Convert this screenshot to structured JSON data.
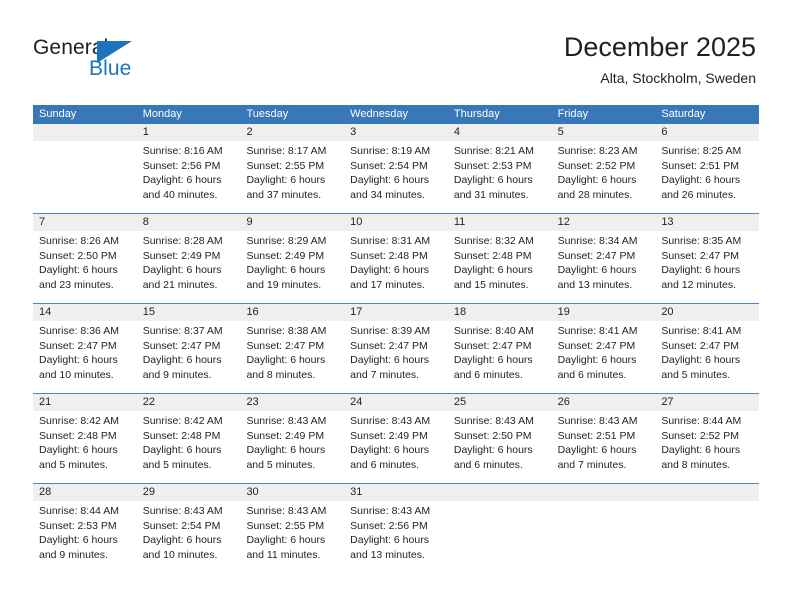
{
  "brand": {
    "name_part1": "General",
    "name_part2": "Blue",
    "accent_color": "#1c75bc"
  },
  "header": {
    "title": "December 2025",
    "subtitle": "Alta, Stockholm, Sweden"
  },
  "calendar": {
    "header_color": "#3878b9",
    "weekdays": [
      "Sunday",
      "Monday",
      "Tuesday",
      "Wednesday",
      "Thursday",
      "Friday",
      "Saturday"
    ],
    "weeks": [
      [
        {
          "day": "",
          "lines": []
        },
        {
          "day": "1",
          "lines": [
            "Sunrise: 8:16 AM",
            "Sunset: 2:56 PM",
            "Daylight: 6 hours",
            "and 40 minutes."
          ]
        },
        {
          "day": "2",
          "lines": [
            "Sunrise: 8:17 AM",
            "Sunset: 2:55 PM",
            "Daylight: 6 hours",
            "and 37 minutes."
          ]
        },
        {
          "day": "3",
          "lines": [
            "Sunrise: 8:19 AM",
            "Sunset: 2:54 PM",
            "Daylight: 6 hours",
            "and 34 minutes."
          ]
        },
        {
          "day": "4",
          "lines": [
            "Sunrise: 8:21 AM",
            "Sunset: 2:53 PM",
            "Daylight: 6 hours",
            "and 31 minutes."
          ]
        },
        {
          "day": "5",
          "lines": [
            "Sunrise: 8:23 AM",
            "Sunset: 2:52 PM",
            "Daylight: 6 hours",
            "and 28 minutes."
          ]
        },
        {
          "day": "6",
          "lines": [
            "Sunrise: 8:25 AM",
            "Sunset: 2:51 PM",
            "Daylight: 6 hours",
            "and 26 minutes."
          ]
        }
      ],
      [
        {
          "day": "7",
          "lines": [
            "Sunrise: 8:26 AM",
            "Sunset: 2:50 PM",
            "Daylight: 6 hours",
            "and 23 minutes."
          ]
        },
        {
          "day": "8",
          "lines": [
            "Sunrise: 8:28 AM",
            "Sunset: 2:49 PM",
            "Daylight: 6 hours",
            "and 21 minutes."
          ]
        },
        {
          "day": "9",
          "lines": [
            "Sunrise: 8:29 AM",
            "Sunset: 2:49 PM",
            "Daylight: 6 hours",
            "and 19 minutes."
          ]
        },
        {
          "day": "10",
          "lines": [
            "Sunrise: 8:31 AM",
            "Sunset: 2:48 PM",
            "Daylight: 6 hours",
            "and 17 minutes."
          ]
        },
        {
          "day": "11",
          "lines": [
            "Sunrise: 8:32 AM",
            "Sunset: 2:48 PM",
            "Daylight: 6 hours",
            "and 15 minutes."
          ]
        },
        {
          "day": "12",
          "lines": [
            "Sunrise: 8:34 AM",
            "Sunset: 2:47 PM",
            "Daylight: 6 hours",
            "and 13 minutes."
          ]
        },
        {
          "day": "13",
          "lines": [
            "Sunrise: 8:35 AM",
            "Sunset: 2:47 PM",
            "Daylight: 6 hours",
            "and 12 minutes."
          ]
        }
      ],
      [
        {
          "day": "14",
          "lines": [
            "Sunrise: 8:36 AM",
            "Sunset: 2:47 PM",
            "Daylight: 6 hours",
            "and 10 minutes."
          ]
        },
        {
          "day": "15",
          "lines": [
            "Sunrise: 8:37 AM",
            "Sunset: 2:47 PM",
            "Daylight: 6 hours",
            "and 9 minutes."
          ]
        },
        {
          "day": "16",
          "lines": [
            "Sunrise: 8:38 AM",
            "Sunset: 2:47 PM",
            "Daylight: 6 hours",
            "and 8 minutes."
          ]
        },
        {
          "day": "17",
          "lines": [
            "Sunrise: 8:39 AM",
            "Sunset: 2:47 PM",
            "Daylight: 6 hours",
            "and 7 minutes."
          ]
        },
        {
          "day": "18",
          "lines": [
            "Sunrise: 8:40 AM",
            "Sunset: 2:47 PM",
            "Daylight: 6 hours",
            "and 6 minutes."
          ]
        },
        {
          "day": "19",
          "lines": [
            "Sunrise: 8:41 AM",
            "Sunset: 2:47 PM",
            "Daylight: 6 hours",
            "and 6 minutes."
          ]
        },
        {
          "day": "20",
          "lines": [
            "Sunrise: 8:41 AM",
            "Sunset: 2:47 PM",
            "Daylight: 6 hours",
            "and 5 minutes."
          ]
        }
      ],
      [
        {
          "day": "21",
          "lines": [
            "Sunrise: 8:42 AM",
            "Sunset: 2:48 PM",
            "Daylight: 6 hours",
            "and 5 minutes."
          ]
        },
        {
          "day": "22",
          "lines": [
            "Sunrise: 8:42 AM",
            "Sunset: 2:48 PM",
            "Daylight: 6 hours",
            "and 5 minutes."
          ]
        },
        {
          "day": "23",
          "lines": [
            "Sunrise: 8:43 AM",
            "Sunset: 2:49 PM",
            "Daylight: 6 hours",
            "and 5 minutes."
          ]
        },
        {
          "day": "24",
          "lines": [
            "Sunrise: 8:43 AM",
            "Sunset: 2:49 PM",
            "Daylight: 6 hours",
            "and 6 minutes."
          ]
        },
        {
          "day": "25",
          "lines": [
            "Sunrise: 8:43 AM",
            "Sunset: 2:50 PM",
            "Daylight: 6 hours",
            "and 6 minutes."
          ]
        },
        {
          "day": "26",
          "lines": [
            "Sunrise: 8:43 AM",
            "Sunset: 2:51 PM",
            "Daylight: 6 hours",
            "and 7 minutes."
          ]
        },
        {
          "day": "27",
          "lines": [
            "Sunrise: 8:44 AM",
            "Sunset: 2:52 PM",
            "Daylight: 6 hours",
            "and 8 minutes."
          ]
        }
      ],
      [
        {
          "day": "28",
          "lines": [
            "Sunrise: 8:44 AM",
            "Sunset: 2:53 PM",
            "Daylight: 6 hours",
            "and 9 minutes."
          ]
        },
        {
          "day": "29",
          "lines": [
            "Sunrise: 8:43 AM",
            "Sunset: 2:54 PM",
            "Daylight: 6 hours",
            "and 10 minutes."
          ]
        },
        {
          "day": "30",
          "lines": [
            "Sunrise: 8:43 AM",
            "Sunset: 2:55 PM",
            "Daylight: 6 hours",
            "and 11 minutes."
          ]
        },
        {
          "day": "31",
          "lines": [
            "Sunrise: 8:43 AM",
            "Sunset: 2:56 PM",
            "Daylight: 6 hours",
            "and 13 minutes."
          ]
        },
        {
          "day": "",
          "lines": []
        },
        {
          "day": "",
          "lines": []
        },
        {
          "day": "",
          "lines": []
        }
      ]
    ]
  }
}
